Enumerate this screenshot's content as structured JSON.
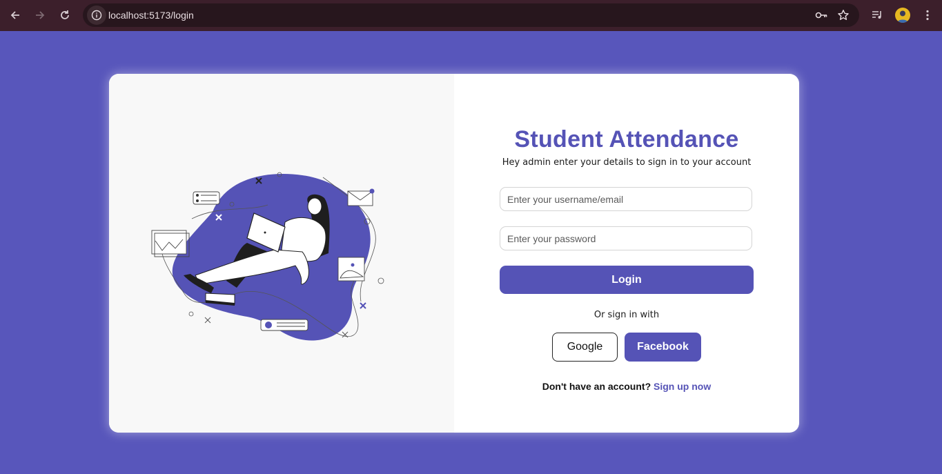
{
  "browser": {
    "url": "localhost:5173/login",
    "icons": [
      "back-arrow-icon",
      "forward-arrow-icon",
      "reload-icon",
      "site-info-icon",
      "password-key-icon",
      "bookmark-star-icon",
      "media-controls-icon",
      "profile-avatar",
      "more-menu-icon"
    ]
  },
  "login": {
    "title": "Student Attendance",
    "subtitle": "Hey admin enter your details to sign in to your account",
    "username_placeholder": "Enter your username/email",
    "password_placeholder": "Enter your password",
    "login_label": "Login",
    "or_text": "Or sign in with",
    "google_label": "Google",
    "facebook_label": "Facebook",
    "signup_question": "Don't have an account?",
    "signup_link": "Sign up now"
  },
  "colors": {
    "page_background": "#5856bb",
    "accent": "#5553b6",
    "card": "#ffffff",
    "illustration_panel": "#f8f8f8",
    "browser_chrome": "#3c1f2b"
  }
}
